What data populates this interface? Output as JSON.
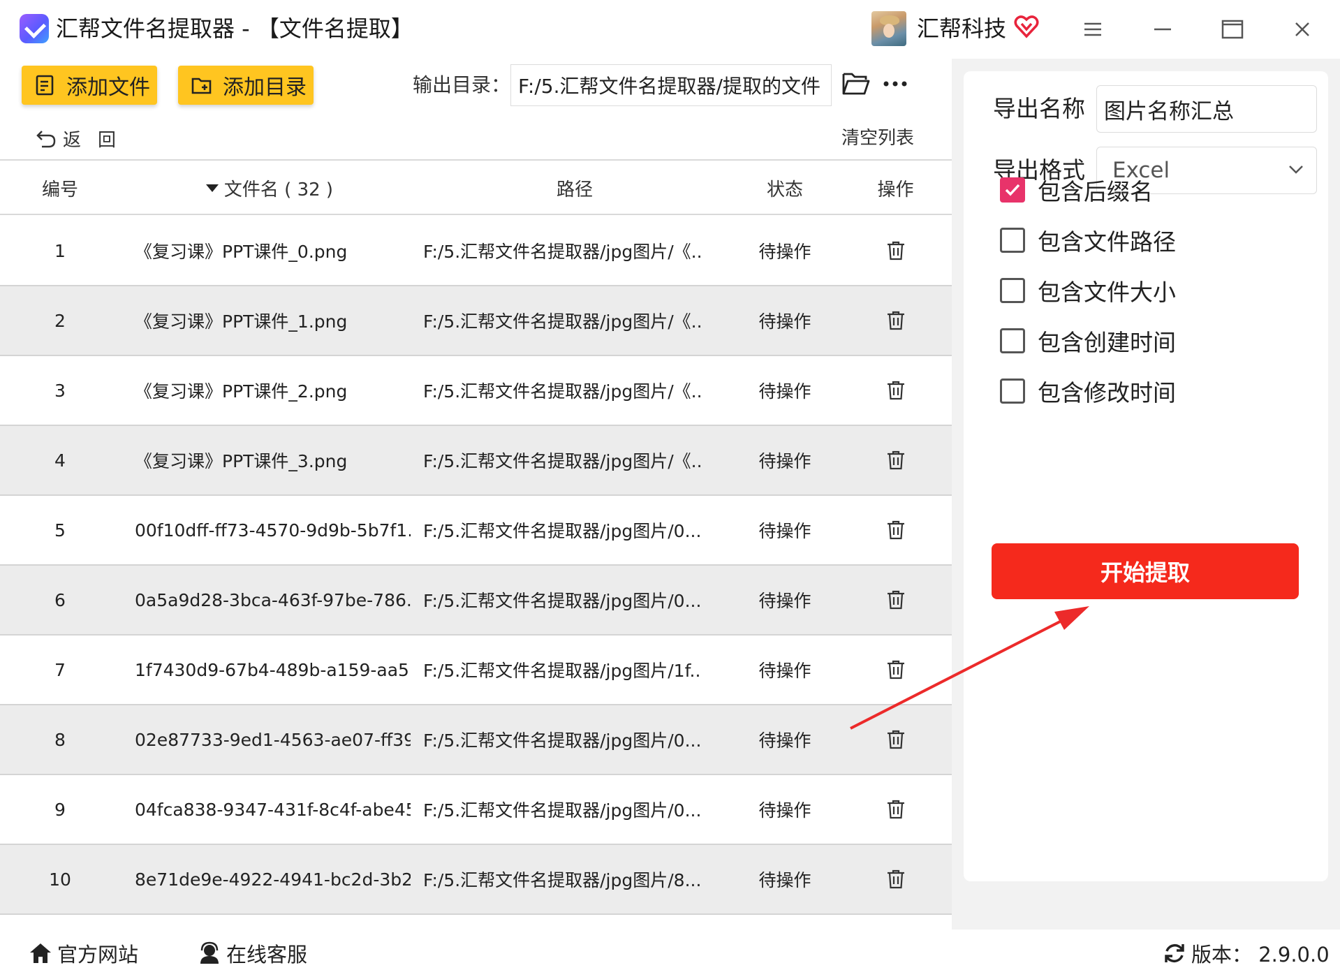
{
  "titlebar": {
    "title": "汇帮文件名提取器 - 【文件名提取】",
    "brand": "汇帮科技",
    "icons": [
      "app-logo",
      "avatar",
      "vip-heart-icon",
      "menu-icon",
      "minimize-icon",
      "maximize-icon",
      "close-icon"
    ]
  },
  "toolbar": {
    "add_file": "添加文件",
    "add_dir": "添加目录",
    "output_label": "输出目录：",
    "output_path": "F:/5.汇帮文件名提取器/提取的文件"
  },
  "nav": {
    "back": "返回",
    "clear": "清空列表"
  },
  "table": {
    "headers": {
      "no": "编号",
      "name": "文件名 ( 32 )",
      "path": "路径",
      "status": "状态",
      "op": "操作"
    },
    "rows": [
      {
        "no": "1",
        "name": "《复习课》PPT课件_0.png",
        "path": "F:/5.汇帮文件名提取器/jpg图片/《...",
        "status": "待操作"
      },
      {
        "no": "2",
        "name": "《复习课》PPT课件_1.png",
        "path": "F:/5.汇帮文件名提取器/jpg图片/《...",
        "status": "待操作"
      },
      {
        "no": "3",
        "name": "《复习课》PPT课件_2.png",
        "path": "F:/5.汇帮文件名提取器/jpg图片/《...",
        "status": "待操作"
      },
      {
        "no": "4",
        "name": "《复习课》PPT课件_3.png",
        "path": "F:/5.汇帮文件名提取器/jpg图片/《...",
        "status": "待操作"
      },
      {
        "no": "5",
        "name": "00f10dff-ff73-4570-9d9b-5b7f1...",
        "path": "F:/5.汇帮文件名提取器/jpg图片/0...",
        "status": "待操作"
      },
      {
        "no": "6",
        "name": "0a5a9d28-3bca-463f-97be-786...",
        "path": "F:/5.汇帮文件名提取器/jpg图片/0...",
        "status": "待操作"
      },
      {
        "no": "7",
        "name": "1f7430d9-67b4-489b-a159-aa5...",
        "path": "F:/5.汇帮文件名提取器/jpg图片/1f...",
        "status": "待操作"
      },
      {
        "no": "8",
        "name": "02e87733-9ed1-4563-ae07-ff39...",
        "path": "F:/5.汇帮文件名提取器/jpg图片/0...",
        "status": "待操作"
      },
      {
        "no": "9",
        "name": "04fca838-9347-431f-8c4f-abe45...",
        "path": "F:/5.汇帮文件名提取器/jpg图片/0...",
        "status": "待操作"
      },
      {
        "no": "10",
        "name": "8e71de9e-4922-4941-bc2d-3b2...",
        "path": "F:/5.汇帮文件名提取器/jpg图片/8...",
        "status": "待操作"
      }
    ]
  },
  "settings": {
    "export_name_label": "导出名称",
    "export_name_value": "图片名称汇总",
    "export_format_label": "导出格式",
    "export_format_value": "Excel",
    "options": [
      {
        "label": "包含后缀名",
        "checked": true
      },
      {
        "label": "包含文件路径",
        "checked": false
      },
      {
        "label": "包含文件大小",
        "checked": false
      },
      {
        "label": "包含创建时间",
        "checked": false
      },
      {
        "label": "包含修改时间",
        "checked": false
      }
    ],
    "start": "开始提取"
  },
  "footer": {
    "site": "官方网站",
    "service": "在线客服",
    "version": "版本：  2.9.0.0"
  },
  "colors": {
    "accent_yellow": "#ffc520",
    "start_red": "#f5291c",
    "check_pink": "#e8336a",
    "arrow_red": "#ec2a2a"
  }
}
